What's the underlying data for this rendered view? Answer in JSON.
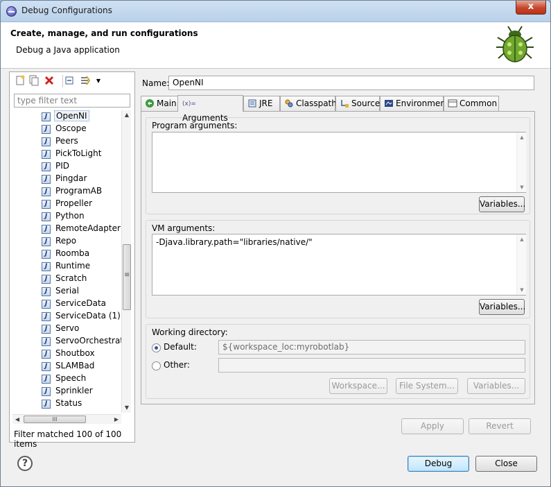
{
  "window": {
    "title": "Debug Configurations",
    "close_label": "x"
  },
  "header": {
    "title": "Create, manage, and run configurations",
    "subtitle": "Debug a Java application",
    "icon": "bug-icon"
  },
  "left_panel": {
    "toolbar_icons": [
      "new-config-icon",
      "duplicate-icon",
      "delete-icon",
      "collapse-all-icon",
      "filter-icon",
      "dropdown-icon"
    ],
    "filter_placeholder": "type filter text",
    "items": [
      "OpenNI",
      "Oscope",
      "Peers",
      "PickToLight",
      "PID",
      "Pingdar",
      "ProgramAB",
      "Propeller",
      "Python",
      "RemoteAdapter",
      "Repo",
      "Roomba",
      "Runtime",
      "Scratch",
      "Serial",
      "ServiceData",
      "ServiceData (1)",
      "Servo",
      "ServoOrchestratc",
      "Shoutbox",
      "SLAMBad",
      "Speech",
      "Sprinkler",
      "Status"
    ],
    "selected": "OpenNI",
    "hscroll_grip": "III",
    "status": "Filter matched 100 of 100 items"
  },
  "config": {
    "name_label": "Name:",
    "name_value": "OpenNI",
    "tabs": [
      {
        "label": "Main",
        "icon": "main-icon"
      },
      {
        "label": "Arguments",
        "icon": "arguments-icon",
        "prefix": "(x)="
      },
      {
        "label": "JRE",
        "icon": "jre-icon"
      },
      {
        "label": "Classpath",
        "icon": "classpath-icon"
      },
      {
        "label": "Source",
        "icon": "source-icon"
      },
      {
        "label": "Environment",
        "icon": "environment-icon"
      },
      {
        "label": "Common",
        "icon": "common-icon"
      }
    ],
    "active_tab": "Arguments",
    "program_args_label": "Program arguments:",
    "program_args_value": "",
    "variables_label": "Variables...",
    "vm_args_label": "VM arguments:",
    "vm_args_value": "-Djava.library.path=\"libraries/native/\"",
    "working_dir_label": "Working directory:",
    "default_label": "Default:",
    "default_value": "${workspace_loc:myrobotlab}",
    "other_label": "Other:",
    "other_value": "",
    "workspace_btn": "Workspace...",
    "filesystem_btn": "File System...",
    "apply_label": "Apply",
    "revert_label": "Revert"
  },
  "footer": {
    "debug_label": "Debug",
    "close_label": "Close",
    "help_icon": "help-icon"
  }
}
